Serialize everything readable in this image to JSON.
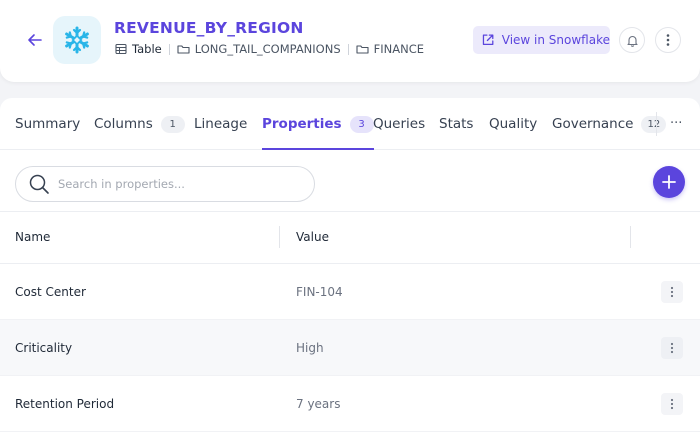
{
  "header": {
    "title": "REVENUE_BY_REGION",
    "entity_type": "Table",
    "breadcrumb": [
      "LONG_TAIL_COMPANIONS",
      "FINANCE"
    ],
    "view_button_label": "View in Snowflake",
    "brand_color": "#5b45dd",
    "logo_icon": "snowflake-icon"
  },
  "tabs": [
    {
      "label": "Summary",
      "count": ""
    },
    {
      "label": "Columns",
      "count": "1"
    },
    {
      "label": "Lineage",
      "count": ""
    },
    {
      "label": "Properties",
      "count": "3",
      "active": true
    },
    {
      "label": "Queries",
      "count": ""
    },
    {
      "label": "Stats",
      "count": ""
    },
    {
      "label": "Quality",
      "count": ""
    },
    {
      "label": "Governance",
      "count": "12"
    }
  ],
  "tabs_more_label": "···",
  "search": {
    "placeholder": "Search in properties..."
  },
  "table": {
    "columns": [
      "Name",
      "Value"
    ],
    "rows": [
      {
        "name": "Cost Center",
        "value": "FIN-104"
      },
      {
        "name": "Criticality",
        "value": "High"
      },
      {
        "name": "Retention Period",
        "value": "7 years"
      }
    ]
  }
}
